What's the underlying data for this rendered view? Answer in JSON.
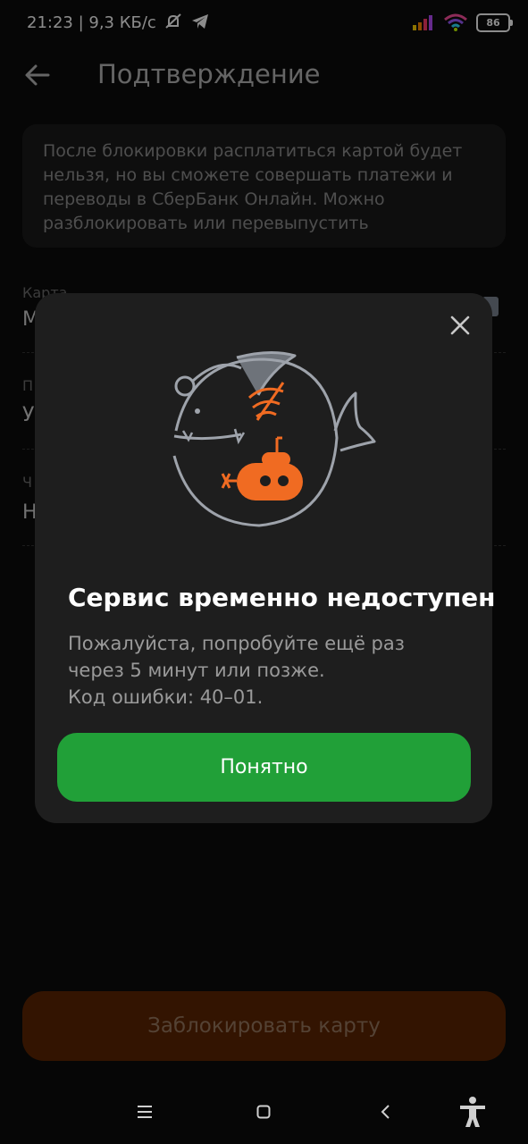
{
  "status_bar": {
    "time": "21:23 | 9,3 КБ/с",
    "battery": "86"
  },
  "header": {
    "title": "Подтверждение"
  },
  "info": {
    "text": "После блокировки расплатиться картой будет нельзя, но вы сможете совершать платежи и переводы в СберБанк Онлайн. Можно разблокировать или перевыпустить"
  },
  "background_fields": [
    {
      "label": "Карта",
      "value": "М"
    },
    {
      "label": "П",
      "value": "У"
    },
    {
      "label": "Ч",
      "value": "Н"
    }
  ],
  "modal": {
    "title": "Сервис временно недоступен",
    "body": "Пожалуйста, попробуйте ещё раз\nчерез 5 минут или позже.\nКод ошибки: 40–01.",
    "button": "Понятно"
  },
  "footer": {
    "block_button": "Заблокировать карту"
  },
  "colors": {
    "accent_green": "#21a038",
    "illustration_orange": "#f06b22",
    "illustration_grey": "#9ea3ab",
    "block_button": "#5e2603"
  },
  "icons": [
    "back-arrow-icon",
    "close-icon",
    "angler-fish-illustration",
    "menu-icon",
    "home-icon",
    "back-nav-icon",
    "accessibility-icon"
  ]
}
